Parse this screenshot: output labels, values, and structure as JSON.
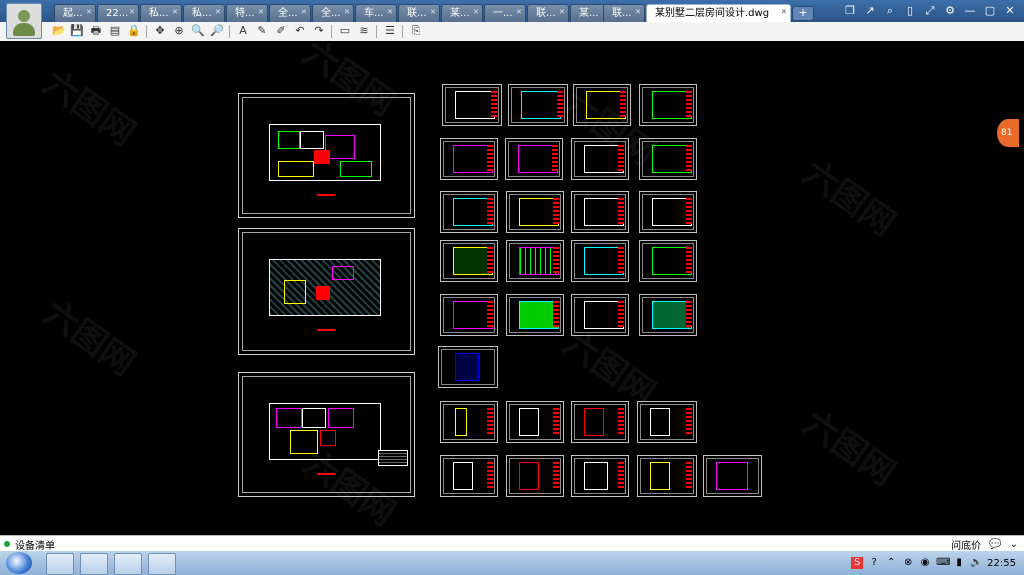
{
  "tabs": [
    {
      "label": "起..."
    },
    {
      "label": "22..."
    },
    {
      "label": "私..."
    },
    {
      "label": "私..."
    },
    {
      "label": "特..."
    },
    {
      "label": "全..."
    },
    {
      "label": "全..."
    },
    {
      "label": "车..."
    },
    {
      "label": "联..."
    },
    {
      "label": "某..."
    },
    {
      "label": "一..."
    },
    {
      "label": "联..."
    },
    {
      "label": "某..."
    },
    {
      "label": "联..."
    }
  ],
  "active_tab": {
    "label": "某别墅二层房间设计.dwg"
  },
  "new_tab_label": "+",
  "window_buttons": [
    "❐",
    "↗",
    "⌕",
    "▯",
    "⤢",
    "⚙",
    "—",
    "▢",
    "✕"
  ],
  "toolbar_icons": [
    "open-icon",
    "save-icon",
    "print-icon",
    "pdf-icon",
    "lock-icon",
    "pan-icon",
    "zoom-window-icon",
    "zoom-in-icon",
    "zoom-out-icon",
    "text-icon",
    "pencil-icon",
    "marker-icon",
    "undo-icon",
    "redo-icon",
    "measure-icon",
    "scale-icon",
    "layers-icon",
    "export-icon"
  ],
  "side_badge": "81",
  "watermark": "六图网",
  "status": {
    "left_text": "设备清单",
    "ask_price": "问底价",
    "chat_icon": "chat-icon"
  },
  "taskbar": {
    "clock": "22:55"
  },
  "colors": {
    "tab_bar": "#2b5488",
    "canvas": "#000000",
    "accent_orange": "#e86a2a",
    "cad_red": "#ff0000",
    "cad_green": "#00ff00",
    "cad_magenta": "#ff00ff",
    "cad_yellow": "#ffff00"
  }
}
